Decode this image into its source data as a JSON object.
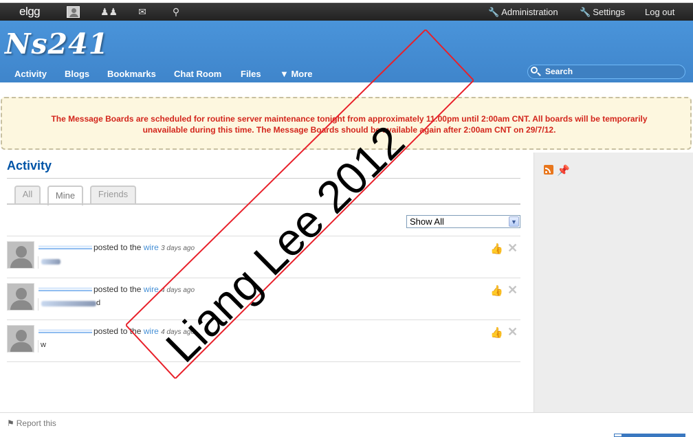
{
  "topbar": {
    "logo": "elgg",
    "icons": [
      "avatar-icon",
      "friends-icon",
      "messages-icon",
      "chat-icon"
    ],
    "links": [
      {
        "label": "Administration",
        "icon": "wrench-icon"
      },
      {
        "label": "Settings",
        "icon": "wrench-icon"
      },
      {
        "label": "Log out"
      }
    ]
  },
  "header": {
    "site_name": "Ns241",
    "nav": [
      "Activity",
      "Blogs",
      "Bookmarks",
      "Chat Room",
      "Files",
      "▼ More"
    ],
    "search_placeholder": "Search"
  },
  "notice": {
    "text": "The Message Boards are scheduled for routine server maintenance tonight from approximately 11:00pm until 2:00am CNT. All boards will be temporarily unavailable during this time. The Message Boards should be available again after 2:00am CNT on 29/7/12."
  },
  "main": {
    "title": "Activity",
    "tabs": [
      {
        "label": "All",
        "active": false
      },
      {
        "label": "Mine",
        "active": true
      },
      {
        "label": "Friends",
        "active": false
      }
    ],
    "filter": {
      "selected": "Show All"
    },
    "items": [
      {
        "action": "posted to the",
        "target": "wire",
        "time": "3 days ago",
        "tail": ""
      },
      {
        "action": "posted to the",
        "target": "wire",
        "time": "4 days ago",
        "tail": "d"
      },
      {
        "action": "posted to the",
        "target": "wire",
        "time": "4 days ago",
        "tail": "w"
      }
    ]
  },
  "footer": {
    "report": "Report this"
  },
  "watermark": {
    "text": "Liang Lee 2012",
    "color": "#e8202a"
  }
}
